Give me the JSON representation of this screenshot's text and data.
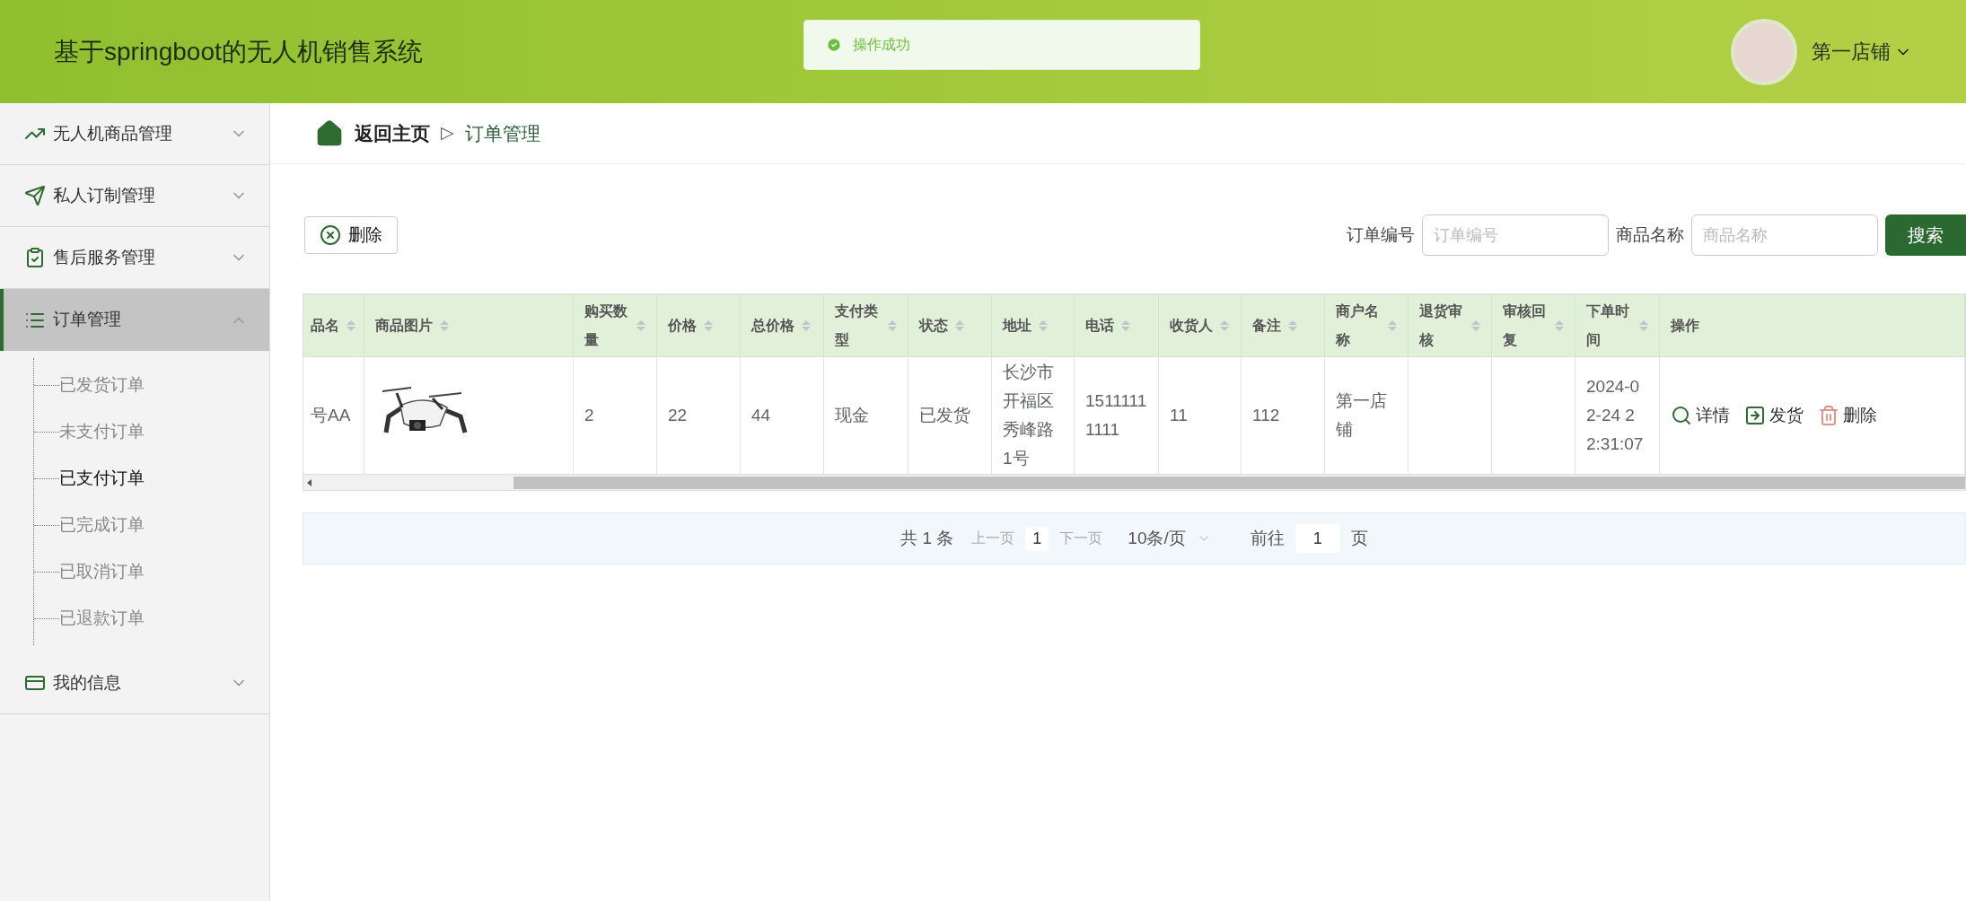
{
  "header": {
    "title": "基于springboot的无人机销售系统",
    "toast": "操作成功",
    "user": "第一店铺"
  },
  "sidebar": {
    "items": [
      {
        "label": "无人机商品管理",
        "expanded": false
      },
      {
        "label": "私人订制管理",
        "expanded": false
      },
      {
        "label": "售后服务管理",
        "expanded": false
      },
      {
        "label": "订单管理",
        "expanded": true,
        "children": [
          {
            "label": "已发货订单",
            "selected": false
          },
          {
            "label": "未支付订单",
            "selected": false
          },
          {
            "label": "已支付订单",
            "selected": true
          },
          {
            "label": "已完成订单",
            "selected": false
          },
          {
            "label": "已取消订单",
            "selected": false
          },
          {
            "label": "已退款订单",
            "selected": false
          }
        ]
      },
      {
        "label": "我的信息",
        "expanded": false
      }
    ]
  },
  "breadcrumb": {
    "home": "返回主页",
    "separator": "▷",
    "current": "订单管理"
  },
  "toolbar": {
    "delete_button": "删除",
    "search_fields": [
      {
        "label": "订单编号",
        "placeholder": "订单编号"
      },
      {
        "label": "商品名称",
        "placeholder": "商品名称"
      }
    ],
    "search_button": "搜索"
  },
  "table": {
    "columns": [
      {
        "label": "品名",
        "sortable": true
      },
      {
        "label": "商品图片",
        "sortable": true
      },
      {
        "label": "购买数量",
        "sortable": true
      },
      {
        "label": "价格",
        "sortable": true
      },
      {
        "label": "总价格",
        "sortable": true
      },
      {
        "label": "支付类型",
        "sortable": true
      },
      {
        "label": "状态",
        "sortable": true
      },
      {
        "label": "地址",
        "sortable": true
      },
      {
        "label": "电话",
        "sortable": true
      },
      {
        "label": "收货人",
        "sortable": true
      },
      {
        "label": "备注",
        "sortable": true
      },
      {
        "label": "商户名称",
        "sortable": true
      },
      {
        "label": "退货审核",
        "sortable": true
      },
      {
        "label": "审核回复",
        "sortable": true
      },
      {
        "label": "下单时间",
        "sortable": true
      },
      {
        "label": "操作",
        "sortable": false
      }
    ],
    "rows": [
      {
        "cells": [
          {
            "kind": "text",
            "text": "号AA"
          },
          {
            "kind": "image"
          },
          {
            "kind": "text",
            "text": "2"
          },
          {
            "kind": "text",
            "text": "22"
          },
          {
            "kind": "text",
            "text": "44"
          },
          {
            "kind": "text",
            "text": "现金"
          },
          {
            "kind": "text",
            "text": "已发货"
          },
          {
            "kind": "text",
            "text": "长沙市开福区秀峰路1号"
          },
          {
            "kind": "text",
            "text": "15111111111"
          },
          {
            "kind": "text",
            "text": "11"
          },
          {
            "kind": "text",
            "text": "112"
          },
          {
            "kind": "text",
            "text": "第一店铺"
          },
          {
            "kind": "empty"
          },
          {
            "kind": "empty"
          },
          {
            "kind": "text",
            "text": "2024-02-24 22:31:07"
          },
          {
            "kind": "actions",
            "actions": [
              {
                "kind": "detail",
                "label": "详情"
              },
              {
                "kind": "ship",
                "label": "发货"
              },
              {
                "kind": "delete",
                "label": "删除"
              }
            ]
          }
        ]
      }
    ]
  },
  "pagination": {
    "total": "共 1 条",
    "prev": "上一页",
    "page": "1",
    "next": "下一页",
    "page_size": "10条/页",
    "goto": "前往",
    "goto_value": "1",
    "goto_suffix": "页"
  }
}
